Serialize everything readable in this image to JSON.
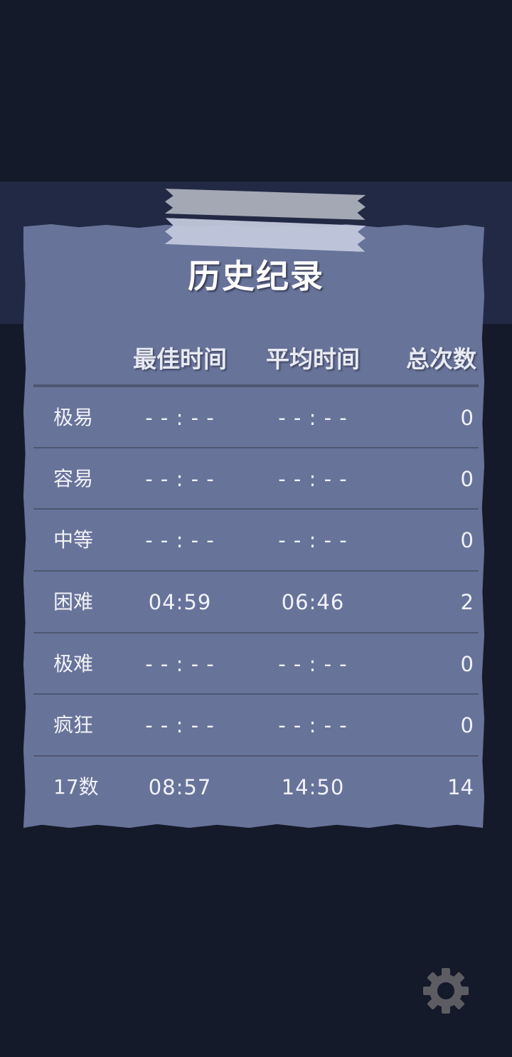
{
  "title": "历史纪录",
  "headers": {
    "best": "最佳时间",
    "average": "平均时间",
    "count": "总次数"
  },
  "rows": [
    {
      "level": "极易",
      "best": "- - : - -",
      "average": "- - : - -",
      "count": "0"
    },
    {
      "level": "容易",
      "best": "- - : - -",
      "average": "- - : - -",
      "count": "0"
    },
    {
      "level": "中等",
      "best": "- - : - -",
      "average": "- - : - -",
      "count": "0"
    },
    {
      "level": "困难",
      "best": "04:59",
      "average": "06:46",
      "count": "2"
    },
    {
      "level": "极难",
      "best": "- - : - -",
      "average": "- - : - -",
      "count": "0"
    },
    {
      "level": "疯狂",
      "best": "- - : - -",
      "average": "- - : - -",
      "count": "0"
    },
    {
      "level": "17数",
      "best": "08:57",
      "average": "14:50",
      "count": "14"
    }
  ],
  "icons": {
    "settings": "gear-icon"
  },
  "colors": {
    "background": "#151a2a",
    "band": "#222944",
    "paper": "#68739a",
    "text": "#f2f3f7"
  }
}
